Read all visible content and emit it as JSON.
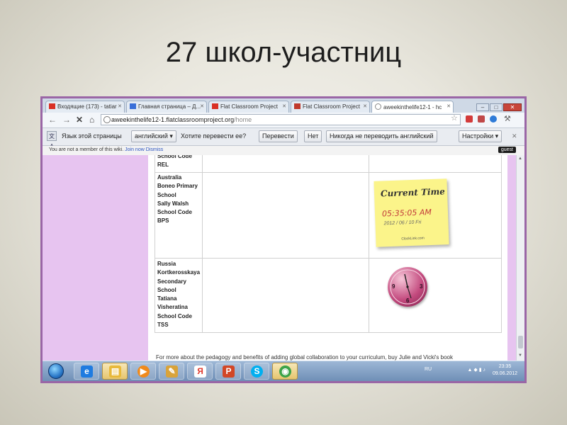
{
  "slide": {
    "title": "27 школ-участниц"
  },
  "browser": {
    "tabs": [
      {
        "label": "Входящие (173) - tatiar",
        "favicon_color": "#d93025",
        "active": false
      },
      {
        "label": "Главная страница – Д...",
        "favicon_color": "#3a6fd8",
        "active": false
      },
      {
        "label": "Flat Classroom Project",
        "favicon_color": "#d93025",
        "active": false
      },
      {
        "label": "Flat Classroom Project",
        "favicon_color": "#c0392b",
        "active": false
      },
      {
        "label": "aweekinthelife12-1 - hc",
        "favicon_color": "#7a7a7a",
        "active": true
      }
    ],
    "window_buttons": {
      "minimize": "–",
      "maximize": "□",
      "close": "✕"
    },
    "url": {
      "host": "aweekinthelife12-1.flatclassroomproject.org",
      "path": "/home"
    },
    "nav_icons": {
      "back": "back-arrow-icon",
      "forward": "forward-arrow-icon",
      "reload": "close-icon",
      "home": "home-icon"
    },
    "nav_glyphs": {
      "back": "←",
      "forward": "→",
      "stop": "✕",
      "home": "⌂",
      "star": "☆",
      "wrench": "⚒"
    },
    "extension_colors": [
      "#d33a3a",
      "#c04848",
      "#2f7bd8",
      "#8b8b8b"
    ]
  },
  "translate_bar": {
    "icon_text": "文A",
    "language_label": "Язык этой страницы",
    "language_value": "английский",
    "question": "Хотите перевести ее?",
    "translate_button": "Перевести",
    "no_button": "Нет",
    "never_button": "Никогда не переводить английский",
    "settings_button": "Настройки",
    "close": "✕"
  },
  "wiki_bar": {
    "message": "You are not a member of this wiki.",
    "join_link": "Join now",
    "dismiss_link": "Dismiss",
    "guest_badge": "guest"
  },
  "content": {
    "row0": {
      "lines": [
        "School Code",
        "REL"
      ]
    },
    "row1": {
      "lines": [
        "Australia",
        "Boneo Primary",
        "School",
        "Sally Walsh",
        "School Code",
        "BPS"
      ]
    },
    "row2": {
      "lines": [
        "Russia",
        "Kortkerosskaya",
        "Secondary",
        "School",
        "Tatiana",
        "Visheratina",
        "School Code",
        "TSS"
      ]
    },
    "widget": {
      "heading": "Current Time",
      "time": "05:35:05 AM",
      "date": "2012 / 06 / 10 Fri",
      "small": "ClockLink.com"
    },
    "clock_numbers": [
      "9",
      "3",
      "6"
    ],
    "footer_text": "For more about the pedagogy and benefits of adding global collaboration to your curriculum, buy Julie and Vicki's book"
  },
  "taskbar": {
    "items": [
      {
        "name": "ie-taskbar-icon",
        "glyph": "e",
        "color": "#1f7be0",
        "active": false
      },
      {
        "name": "explorer-taskbar-icon",
        "glyph": "▤",
        "color": "#e8b93a",
        "active": true
      },
      {
        "name": "media-player-taskbar-icon",
        "glyph": "▶",
        "color": "#f08a1c",
        "active": false
      },
      {
        "name": "paint-taskbar-icon",
        "glyph": "✎",
        "color": "#d9a33a",
        "active": false
      },
      {
        "name": "yandex-taskbar-icon",
        "glyph": "Я",
        "color": "#e03a2e",
        "active": false
      },
      {
        "name": "powerpoint-taskbar-icon",
        "glyph": "P",
        "color": "#d24726",
        "active": false
      },
      {
        "name": "skype-taskbar-icon",
        "glyph": "S",
        "color": "#00aff0",
        "active": false
      },
      {
        "name": "chrome-taskbar-icon",
        "glyph": "◉",
        "color": "#3da349",
        "active": true
      }
    ],
    "language": "RU",
    "tray_glyphs": "▲ ◆ ▮ ♪",
    "time": "23:35",
    "date": "09.06.2012"
  }
}
